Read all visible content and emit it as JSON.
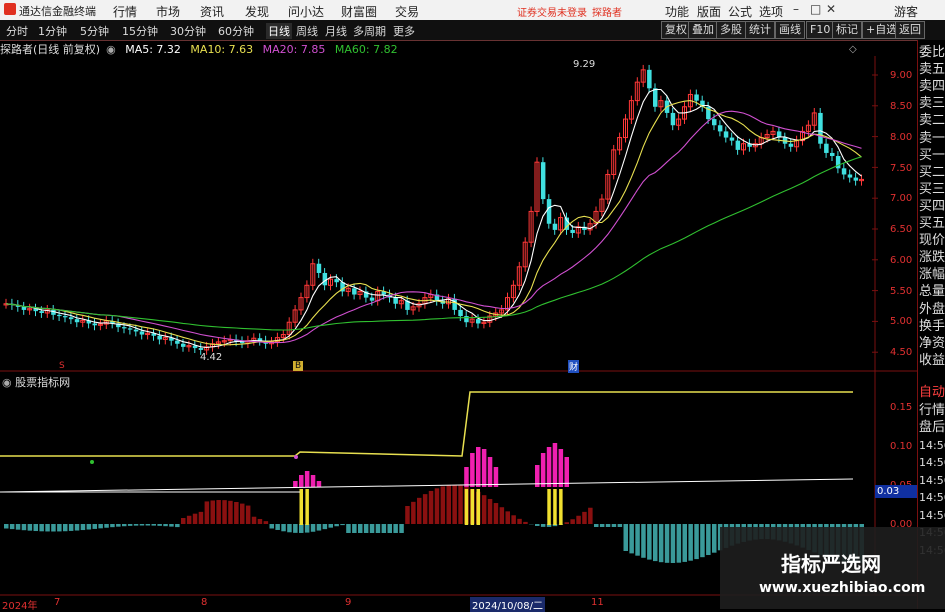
{
  "menubar": {
    "app_name": "通达信金融终端",
    "menus": [
      "行情",
      "市场",
      "资讯",
      "发现",
      "问小达",
      "财富圈",
      "交易"
    ],
    "login_warning": "证券交易未登录",
    "user_label": "探路者",
    "right_menus": [
      "功能",
      "版面",
      "公式",
      "选项"
    ],
    "guest": "游客"
  },
  "toolbar": {
    "periods": [
      "分时",
      "1分钟",
      "5分钟",
      "15分钟",
      "30分钟",
      "60分钟",
      "日线",
      "周线",
      "月线",
      "多周期",
      "更多"
    ],
    "active_period": "日线",
    "right_buttons": [
      "复权",
      "叠加",
      "多股",
      "统计",
      "画线",
      "F10",
      "标记",
      "+自选",
      "返回"
    ]
  },
  "info": {
    "stock": "探路者(日线 前复权)",
    "ma5": "MA5: 7.32",
    "ma10": "MA10: 7.63",
    "ma20": "MA20: 7.85",
    "ma60": "MA60: 7.82",
    "colors": {
      "ma5": "#ffffff",
      "ma10": "#e8e050",
      "ma20": "#d050d0",
      "ma60": "#30c030"
    }
  },
  "price_axis": {
    "ticks": [
      "9.00",
      "8.50",
      "8.00",
      "7.50",
      "7.00",
      "6.50",
      "6.00",
      "5.50",
      "5.00",
      "4.50"
    ],
    "high_label": "9.29",
    "low_label": "4.42"
  },
  "indicator": {
    "title": "股票指标网",
    "ticks": [
      "0.15",
      "0.10",
      "0.05",
      "0.00"
    ],
    "value_box": "0.03"
  },
  "right_panel": {
    "labels": [
      "委比",
      "卖五",
      "卖四",
      "卖三",
      "卖二",
      "卖一",
      "买一",
      "买二",
      "买三",
      "买四",
      "买五",
      "现价",
      "涨跌",
      "涨幅",
      "总量",
      "外盘",
      "换手",
      "净资",
      "收益"
    ],
    "lower_labels": [
      "自动",
      "行情",
      "盘后",
      "14:56",
      "14:56",
      "14:56",
      "14:56",
      "14:56",
      "14:56",
      "14:56"
    ]
  },
  "x_axis": {
    "ticks": [
      "2024年",
      "7",
      "8",
      "9",
      "2024/10/08/二",
      "11"
    ]
  },
  "markers": {
    "m1": "S",
    "m2": "B",
    "m3": "财"
  },
  "watermark": {
    "line1": "指标严选网",
    "line2": "www.xuezhibiao.com"
  }
}
